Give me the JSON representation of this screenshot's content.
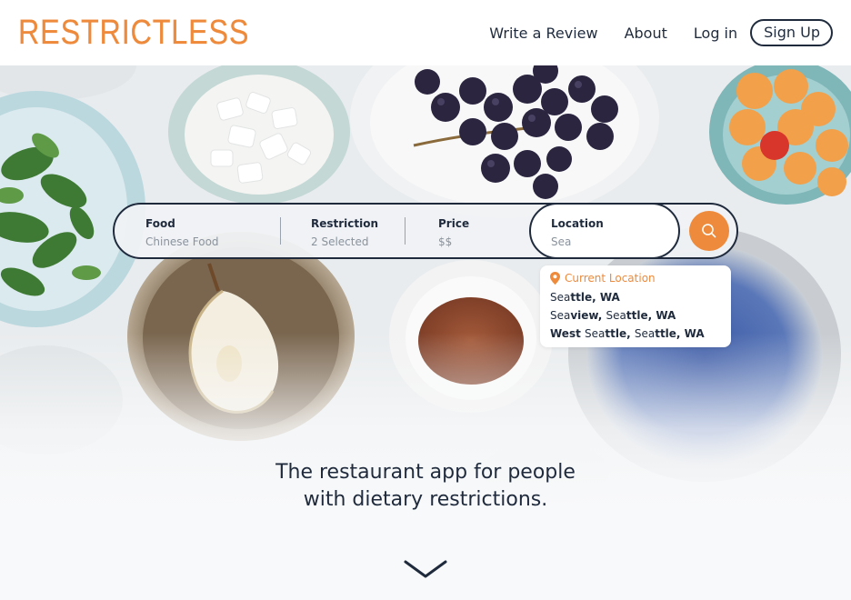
{
  "brand": {
    "logo_text": "RESTRICTLESS",
    "accent_color": "#ee8a3b",
    "text_color": "#1f2b3d"
  },
  "nav": {
    "write_review": "Write a Review",
    "about": "About",
    "login": "Log in",
    "signup": "Sign Up"
  },
  "search": {
    "food": {
      "label": "Food",
      "value": "Chinese Food"
    },
    "restriction": {
      "label": "Restriction",
      "value": "2 Selected"
    },
    "price": {
      "label": "Price",
      "value": "$$"
    },
    "location": {
      "label": "Location",
      "value": "Sea"
    },
    "button_icon": "search-icon"
  },
  "suggestions": {
    "current_location": "Current Location",
    "items": [
      {
        "pre": "Sea",
        "bold": "ttle, WA",
        "rest": ""
      },
      {
        "pre": "Sea",
        "bold": "view, ",
        "mid": "Sea",
        "bold2": "ttle, WA"
      },
      {
        "bold": "West ",
        "mid": "Sea",
        "bold2": "ttle, ",
        "mid2": "Sea",
        "bold3": "ttle, WA"
      }
    ]
  },
  "tagline": {
    "line1": "The restaurant app for people",
    "line2": "with dietary restrictions."
  },
  "scroll_icon": "chevron-down-icon"
}
